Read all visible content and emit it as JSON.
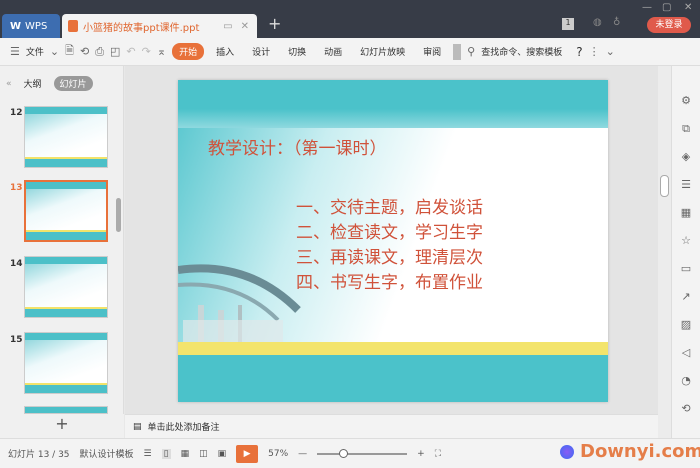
{
  "titlebar": {
    "wps_label": "WPS",
    "doc_tab": "小篮猪的故事ppt课件.ppt",
    "login": "未登录",
    "page_badge": "1"
  },
  "toolbar": {
    "file": "文件",
    "start": "开始",
    "insert": "插入",
    "design": "设计",
    "transition": "切换",
    "animation": "动画",
    "slideshow": "幻灯片放映",
    "review": "审阅",
    "search": "查找命令、搜索模板",
    "help": "?"
  },
  "leftpane": {
    "outline_tab": "大纲",
    "slides_tab": "幻灯片",
    "thumbs": [
      {
        "num": "12"
      },
      {
        "num": "13",
        "selected": true
      },
      {
        "num": "14"
      },
      {
        "num": "15"
      }
    ]
  },
  "slide": {
    "title": "教学设计：（第一课时）",
    "items": [
      "一、交待主题，启发谈话",
      "二、检查读文，学习生字",
      "三、再读课文，理清层次",
      "四、书写生字，布置作业"
    ]
  },
  "notes": {
    "placeholder": "单击此处添加备注"
  },
  "status": {
    "slide_counter": "幻灯片 13 / 35",
    "template": "默认设计模板",
    "zoom": "57%",
    "watermark": "Downyi.com"
  },
  "colors": {
    "accent": "#e8713a",
    "teal": "#4bc2ca",
    "title_red": "#d0523a"
  }
}
